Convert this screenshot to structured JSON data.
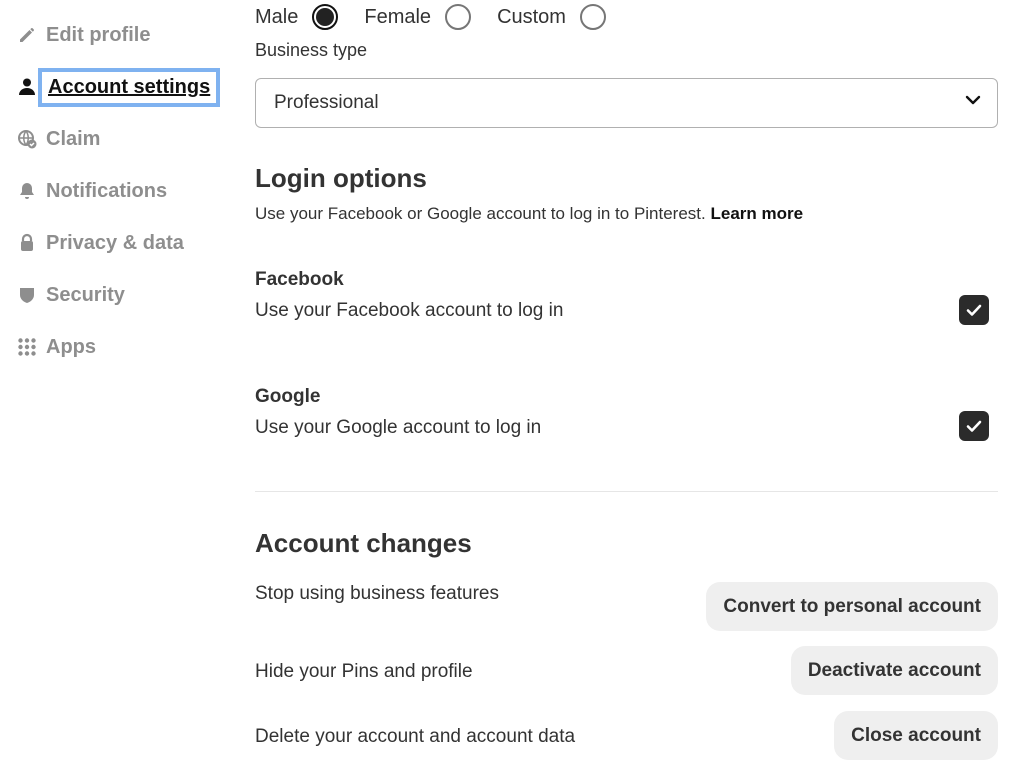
{
  "sidebar": {
    "items": [
      {
        "label": "Edit profile",
        "icon": "pencil-icon"
      },
      {
        "label": "Account settings",
        "icon": "person-icon",
        "active": true
      },
      {
        "label": "Claim",
        "icon": "globe-check-icon"
      },
      {
        "label": "Notifications",
        "icon": "bell-icon"
      },
      {
        "label": "Privacy & data",
        "icon": "lock-icon"
      },
      {
        "label": "Security",
        "icon": "shield-icon"
      },
      {
        "label": "Apps",
        "icon": "grid-icon"
      }
    ]
  },
  "gender": {
    "options": [
      {
        "label": "Male",
        "checked": true
      },
      {
        "label": "Female",
        "checked": false
      },
      {
        "label": "Custom",
        "checked": false
      }
    ]
  },
  "business_type": {
    "label": "Business type",
    "value": "Professional",
    "icon": "chevron-down-icon"
  },
  "login_options": {
    "heading": "Login options",
    "description": "Use your Facebook or Google account to log in to Pinterest.",
    "learn_more": "Learn more",
    "facebook": {
      "title": "Facebook",
      "description": "Use your Facebook account to log in",
      "checked": true
    },
    "google": {
      "title": "Google",
      "description": "Use your Google account to log in",
      "checked": true
    }
  },
  "account_changes": {
    "heading": "Account changes",
    "rows": [
      {
        "text": "Stop using business features",
        "button": "Convert to personal account"
      },
      {
        "text": "Hide your Pins and profile",
        "button": "Deactivate account"
      },
      {
        "text": "Delete your account and account data",
        "button": "Close account"
      }
    ]
  },
  "colors": {
    "focus_ring": "#7fb2f0",
    "checkbox_fill": "#2b2b2b",
    "button_bg": "#efefef",
    "inactive_nav": "#8e8e8e"
  }
}
